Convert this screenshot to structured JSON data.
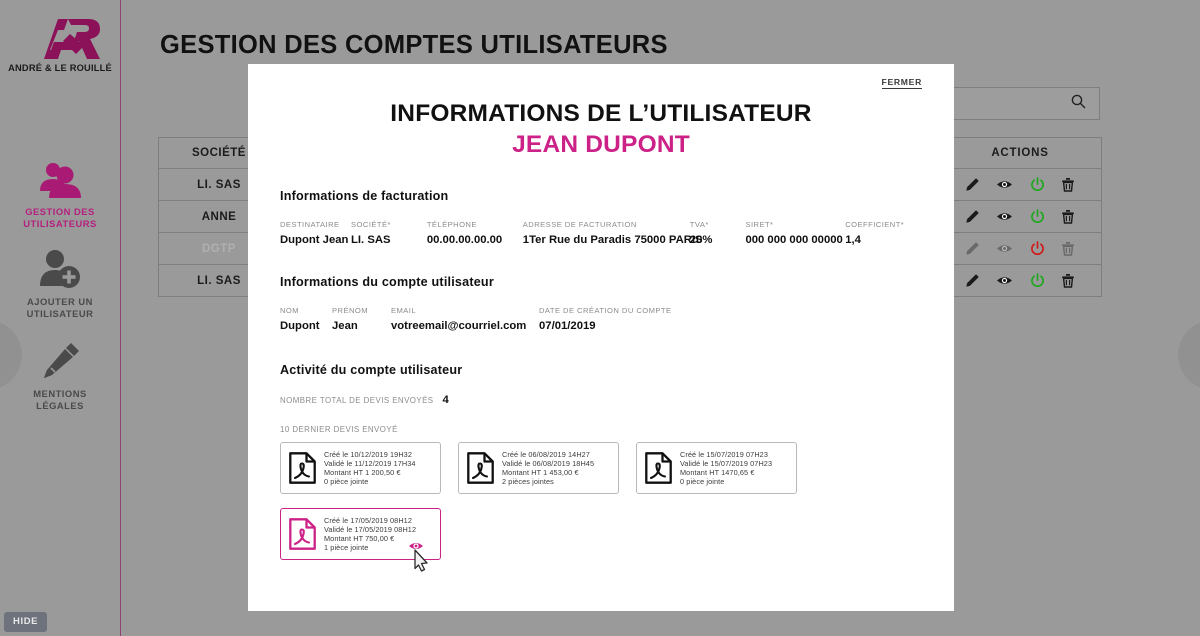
{
  "brand": {
    "accent": "#cc2287",
    "logo_dark": "#8b1158",
    "logo_text": "ANDRÉ & LE ROUILLÉ",
    "logo_mark": "ar-monogram"
  },
  "sidebar": {
    "items": [
      {
        "label": "GESTION DES\nUTILISATEURS",
        "line1": "GESTION DES",
        "line2": "UTILISATEURS",
        "icon": "users-icon",
        "active": true
      },
      {
        "label": "AJOUTER UN\nUTILISATEUR",
        "line1": "AJOUTER UN",
        "line2": "UTILISATEUR",
        "icon": "user-plus-icon",
        "active": false
      },
      {
        "label": "MENTIONS\nLÉGALES",
        "line1": "MENTIONS",
        "line2": "LÉGALES",
        "icon": "pen-nib-icon",
        "active": false
      }
    ]
  },
  "hide_button": {
    "label": "HIDE"
  },
  "edge_nav": {
    "left_icon": "chevron-left-icon",
    "right_icon": "chevron-right-icon"
  },
  "page": {
    "title": "GESTION DES COMPTES UTILISATEURS",
    "search": {
      "value": "",
      "placeholder": "",
      "icon": "search-icon"
    },
    "table": {
      "columns": [
        "SOCIÉTÉ",
        "ACTIONS"
      ],
      "action_icons": [
        "pencil-icon",
        "eye-icon",
        "power-icon",
        "trash-icon"
      ],
      "rows": [
        {
          "societe": "LI. SAS",
          "enabled": true,
          "power_color": "#1fa81f"
        },
        {
          "societe": "ANNE",
          "enabled": true,
          "power_color": "#1fa81f"
        },
        {
          "societe": "DGTP",
          "enabled": false,
          "power_color": "#d01b1b"
        },
        {
          "societe": "LI. SAS",
          "enabled": true,
          "power_color": "#1fa81f"
        }
      ]
    }
  },
  "modal": {
    "close_label": "FERMER",
    "title": "INFORMATIONS DE L’UTILISATEUR",
    "subtitle": "JEAN DUPONT",
    "billing": {
      "heading": "Informations de facturation",
      "fields": [
        {
          "label": "DESTINATAIRE",
          "value": "Dupont Jean"
        },
        {
          "label": "SOCIÉTÉ*",
          "value": "LI. SAS"
        },
        {
          "label": "TÉLÉPHONE",
          "value": "00.00.00.00.00"
        },
        {
          "label": "ADRESSE DE FACTURATION",
          "value": "1Ter Rue du Paradis 75000 PARIS"
        },
        {
          "label": "TVA*",
          "value": "20%"
        },
        {
          "label": "SIRET*",
          "value": "000 000 000 00000"
        },
        {
          "label": "COEFFICIENT*",
          "value": "1,4"
        }
      ]
    },
    "account": {
      "heading": "Informations du compte utilisateur",
      "fields": [
        {
          "label": "NOM",
          "value": "Dupont"
        },
        {
          "label": "PRÉNOM",
          "value": "Jean"
        },
        {
          "label": "EMAIL",
          "value": "votreemail@courriel.com"
        },
        {
          "label": "DATE DE CRÉATION DU COMPTE",
          "value": "07/01/2019"
        }
      ]
    },
    "activity": {
      "heading": "Activité du compte utilisateur",
      "total_label": "NOMBRE TOTAL DE DEVIS ENVOYÉS",
      "total_value": "4",
      "list_caption": "10 DERNIER DEVIS ENVOYÉ",
      "quotes": [
        {
          "icon": "pdf-icon",
          "created": "Créé le 10/12/2019 19H32",
          "validated": "Validé le 11/12/2019 17H34",
          "amount": "Montant HT 1 200,50 €",
          "attachments": "0 pièce jointe",
          "selected": false
        },
        {
          "icon": "pdf-icon",
          "created": "Créé le 06/08/2019 14H27",
          "validated": "Validé le 06/08/2019 18H45",
          "amount": "Montant HT 1 453,00 €",
          "attachments": "2 pièces jointes",
          "selected": false
        },
        {
          "icon": "pdf-icon",
          "created": "Créé le 15/07/2019 07H23",
          "validated": "Validé le 15/07/2019 07H23",
          "amount": "Montant HT 1470,65 €",
          "attachments": "0 pièce jointe",
          "selected": false
        },
        {
          "icon": "pdf-icon",
          "created": "Créé le 17/05/2019 08H12",
          "validated": "Validé le 17/05/2019 08H12",
          "amount": "Montant HT 750,00 €",
          "attachments": "1 pièce jointe",
          "selected": true
        }
      ]
    }
  }
}
